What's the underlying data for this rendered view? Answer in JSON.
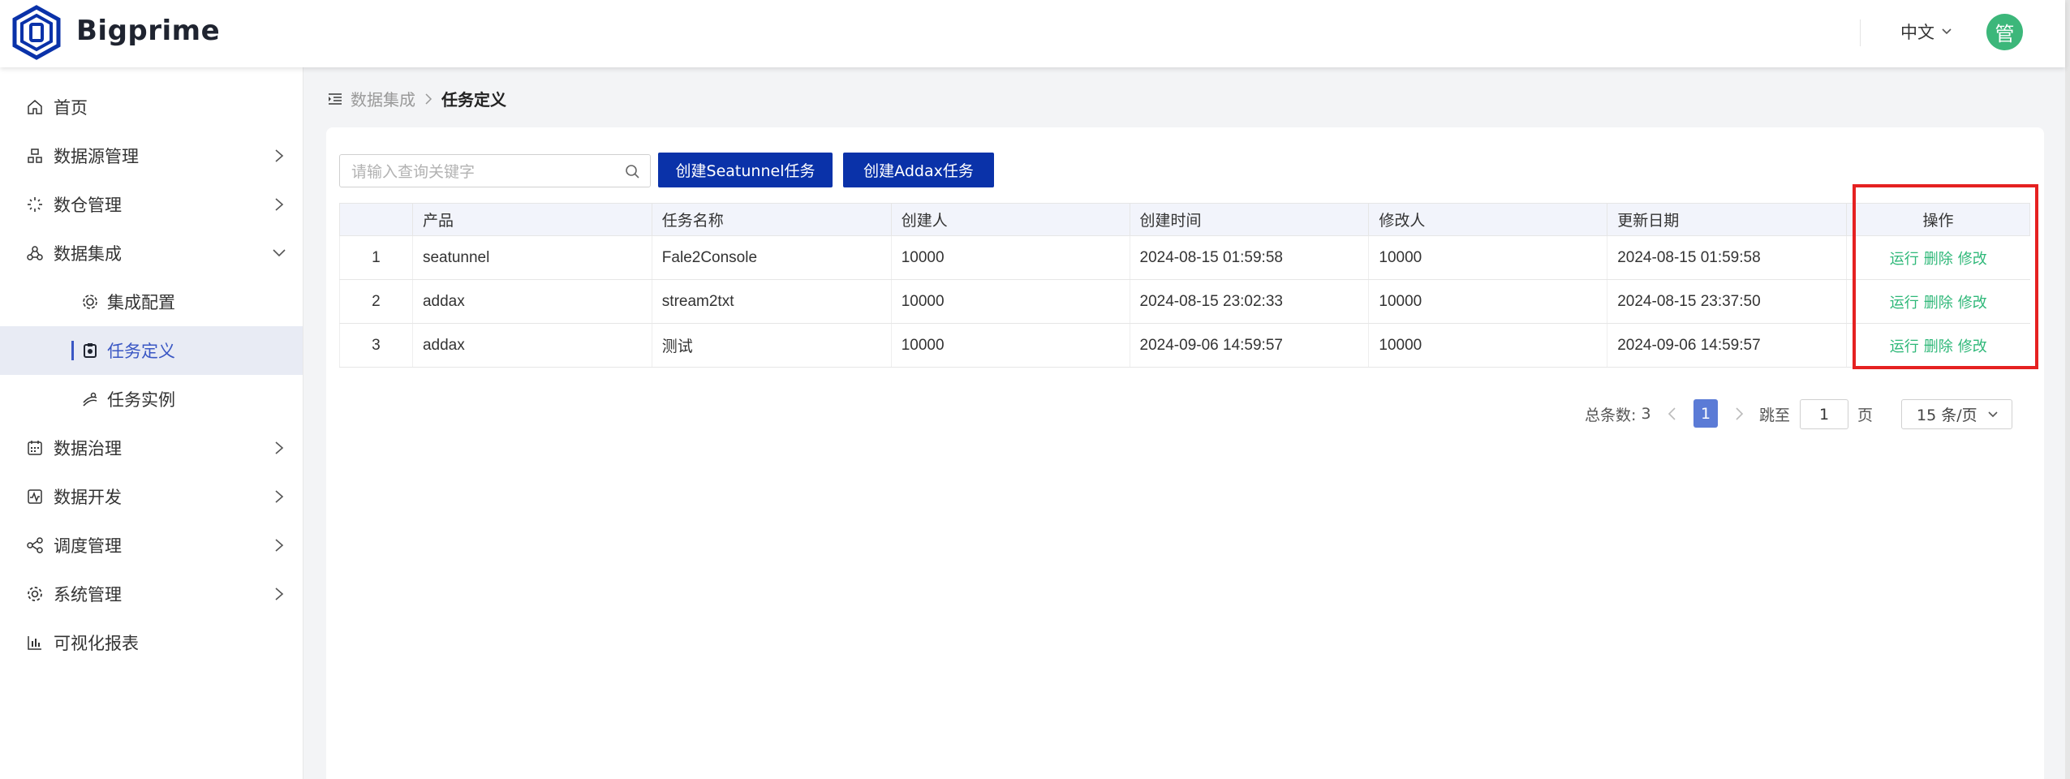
{
  "app": {
    "brand": "Bigprime",
    "language": "中文",
    "avatar_text": "管"
  },
  "sidebar": {
    "items": [
      {
        "label": "首页"
      },
      {
        "label": "数据源管理"
      },
      {
        "label": "数仓管理"
      },
      {
        "label": "数据集成"
      },
      {
        "label": "集成配置"
      },
      {
        "label": "任务定义"
      },
      {
        "label": "任务实例"
      },
      {
        "label": "数据治理"
      },
      {
        "label": "数据开发"
      },
      {
        "label": "调度管理"
      },
      {
        "label": "系统管理"
      },
      {
        "label": "可视化报表"
      }
    ]
  },
  "breadcrumb": {
    "parent": "数据集成",
    "current": "任务定义"
  },
  "toolbar": {
    "search_placeholder": "请输入查询关键字",
    "create_seatunnel": "创建Seatunnel任务",
    "create_addax": "创建Addax任务"
  },
  "table": {
    "columns": [
      "",
      "产品",
      "任务名称",
      "创建人",
      "创建时间",
      "修改人",
      "更新日期",
      "操作"
    ],
    "rows": [
      {
        "index": "1",
        "product": "seatunnel",
        "name": "Fale2Console",
        "creator": "10000",
        "created": "2024-08-15 01:59:58",
        "modifier": "10000",
        "updated": "2024-08-15 01:59:58"
      },
      {
        "index": "2",
        "product": "addax",
        "name": "stream2txt",
        "creator": "10000",
        "created": "2024-08-15 23:02:33",
        "modifier": "10000",
        "updated": "2024-08-15 23:37:50"
      },
      {
        "index": "3",
        "product": "addax",
        "name": "测试",
        "creator": "10000",
        "created": "2024-09-06 14:59:57",
        "modifier": "10000",
        "updated": "2024-09-06 14:59:57"
      }
    ],
    "actions": {
      "run": "运行",
      "delete": "删除",
      "edit": "修改"
    }
  },
  "pagination": {
    "total_label": "总条数:",
    "total": "3",
    "current_page": "1",
    "jump_label": "跳至",
    "jump_value": "1",
    "page_suffix": "页",
    "page_size": "15 条/页"
  },
  "colors": {
    "primary_button": "#0a32a9",
    "action": "#2fb879",
    "highlight": "#e52121",
    "active_menu": "#3a57c4"
  }
}
